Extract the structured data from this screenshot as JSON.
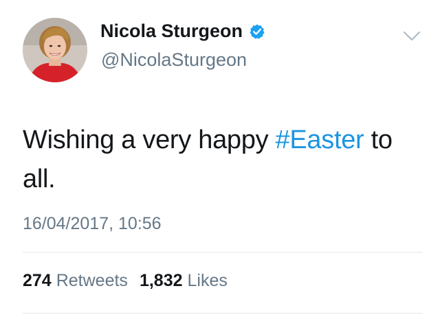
{
  "user": {
    "display_name": "Nicola Sturgeon",
    "handle": "@NicolaSturgeon",
    "verified": true
  },
  "tweet": {
    "text_before": "Wishing a very happy ",
    "hashtag": "#Easter",
    "text_after": " to all.",
    "timestamp": "16/04/2017, 10:56"
  },
  "stats": {
    "retweets_count": "274",
    "retweets_label": "Retweets",
    "likes_count": "1,832",
    "likes_label": "Likes"
  },
  "colors": {
    "hashtag": "#1b95e0",
    "secondary_text": "#657786",
    "verified_badge": "#1da1f2",
    "divider": "#e1e8ed"
  },
  "icons": {
    "verified": "verified-badge-icon",
    "menu": "chevron-down-icon"
  }
}
